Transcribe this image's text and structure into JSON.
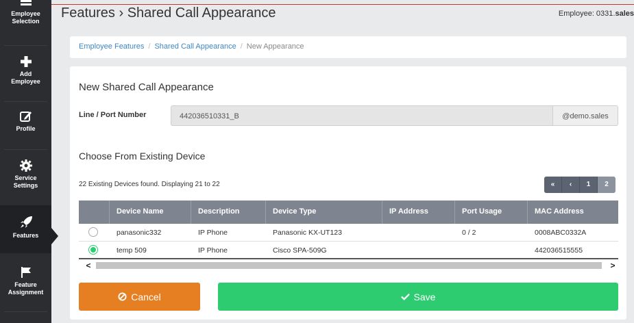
{
  "sidebar": {
    "items": [
      {
        "label": "Employee Selection",
        "icon": "list-icon"
      },
      {
        "label": "Add Employee",
        "icon": "plus-icon"
      },
      {
        "label": "Profile",
        "icon": "edit-icon"
      },
      {
        "label": "Service Settings",
        "icon": "gear-icon"
      },
      {
        "label": "Features",
        "icon": "rocket-icon",
        "active": true
      },
      {
        "label": "Feature Assignment",
        "icon": "flag-icon"
      }
    ]
  },
  "header": {
    "title": "Features › Shared Call Appearance",
    "employee_prefix": "Employee: 0331.",
    "employee_bold": "sales"
  },
  "breadcrumb": {
    "items": [
      "Employee Features",
      "Shared Call Appearance"
    ],
    "current": "New Appearance",
    "separator": "/"
  },
  "form": {
    "title": "New Shared Call Appearance",
    "line_label": "Line / Port Number",
    "line_value": "442036510331_B",
    "domain_addon": "@demo.sales"
  },
  "devices": {
    "title": "Choose From Existing Device",
    "found_text": "22 Existing Devices found. Displaying 21 to 22",
    "pager": [
      "«",
      "‹",
      "1",
      "2"
    ],
    "columns": [
      "Device Name",
      "Description",
      "Device Type",
      "IP Address",
      "Port Usage",
      "MAC Address"
    ],
    "rows": [
      {
        "selected": false,
        "cells": [
          "panasonic332",
          "IP Phone",
          "Panasonic KX-UT123",
          "",
          "0 / 2",
          "0008ABC0332A"
        ]
      },
      {
        "selected": true,
        "cells": [
          "temp 509",
          "IP Phone",
          "Cisco SPA-509G",
          "",
          "",
          "442036515555"
        ]
      }
    ],
    "scroll_left": "<",
    "scroll_right": ">"
  },
  "actions": {
    "cancel_label": "Cancel",
    "save_label": "Save"
  },
  "colors": {
    "sidebar_bg": "#2b2d31",
    "cancel": "#e67e22",
    "save": "#2ecc71",
    "link": "#3a87c8",
    "table_header": "#7f8590"
  }
}
